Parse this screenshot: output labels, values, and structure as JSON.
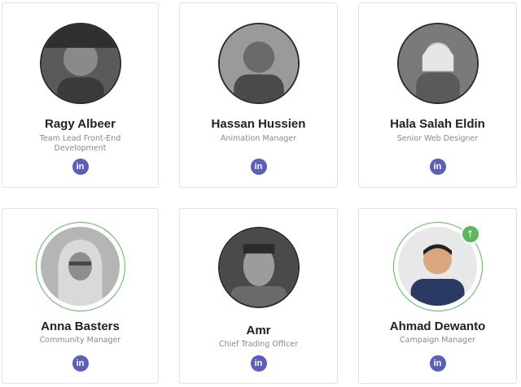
{
  "team": [
    {
      "name": "Ragy Albeer",
      "role": "Team Lead Front-End Development",
      "social_icon": "linkedin-icon",
      "social_label": "in",
      "ring": false
    },
    {
      "name": "Hassan Hussien",
      "role": "Animation Manager",
      "social_icon": "linkedin-icon",
      "social_label": "in",
      "ring": false
    },
    {
      "name": "Hala Salah Eldin",
      "role": "Senior Web Designer",
      "social_icon": "linkedin-icon",
      "social_label": "in",
      "ring": false
    },
    {
      "name": "Anna Basters",
      "role": "Community Manager",
      "social_icon": "linkedin-icon",
      "social_label": "in",
      "ring": true
    },
    {
      "name": "Amr",
      "role": "Chief Trading Officer",
      "social_icon": "linkedin-icon",
      "social_label": "in",
      "ring": false
    },
    {
      "name": "Ahmad Dewanto",
      "role": "Campaign Manager",
      "social_icon": "linkedin-icon",
      "social_label": "in",
      "ring": true,
      "badge_icon": "arrow-up-icon"
    }
  ],
  "colors": {
    "card_border": "#e2e2e2",
    "social_bg": "#5b5fb8",
    "ring_green": "#5cb85c",
    "name": "#222222",
    "role": "#888888"
  }
}
